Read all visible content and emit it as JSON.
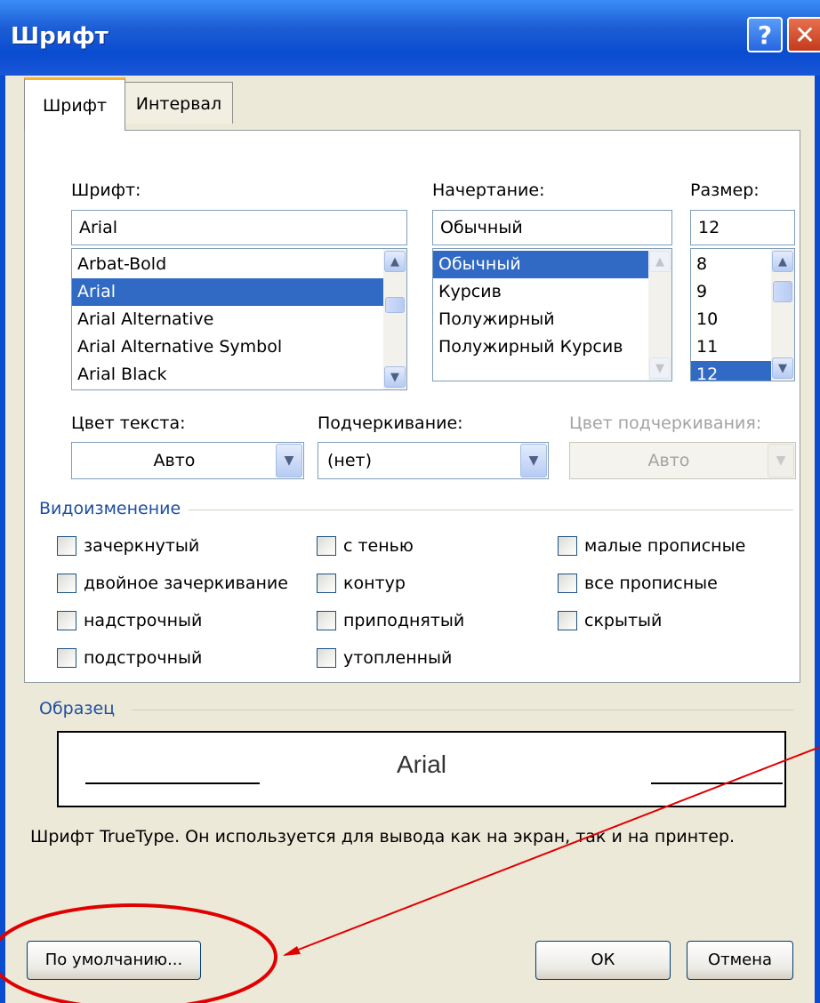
{
  "window": {
    "title": "Шрифт",
    "help_label": "?",
    "close_label": "✕"
  },
  "tabs": [
    {
      "label": "Шрифт"
    },
    {
      "label": "Интервал"
    }
  ],
  "font": {
    "label": "Шрифт:",
    "value": "Arial",
    "items": [
      "Arbat-Bold",
      "Arial",
      "Arial Alternative",
      "Arial Alternative Symbol",
      "Arial Black"
    ],
    "selected": "Arial"
  },
  "style": {
    "label": "Начертание:",
    "value": "Обычный",
    "items": [
      "Обычный",
      "Курсив",
      "Полужирный",
      "Полужирный Курсив"
    ],
    "selected": "Обычный"
  },
  "size": {
    "label": "Размер:",
    "value": "12",
    "items": [
      "8",
      "9",
      "10",
      "11",
      "12"
    ],
    "selected": "12"
  },
  "text_color": {
    "label": "Цвет текста:",
    "value": "Авто"
  },
  "underline": {
    "label": "Подчеркивание:",
    "value": "(нет)"
  },
  "underline_color": {
    "label": "Цвет подчеркивания:",
    "value": "Авто"
  },
  "effects": {
    "title": "Видоизменение",
    "col1": [
      "зачеркнутый",
      "двойное зачеркивание",
      "надстрочный",
      "подстрочный"
    ],
    "col2": [
      "с тенью",
      "контур",
      "приподнятый",
      "утопленный"
    ],
    "col3": [
      "малые прописные",
      "все прописные",
      "скрытый"
    ]
  },
  "preview": {
    "title": "Образец",
    "text": "Arial",
    "description": "Шрифт TrueType. Он используется для вывода как на экран, так и на принтер."
  },
  "buttons": {
    "default": "По умолчанию...",
    "ok": "ОК",
    "cancel": "Отмена"
  },
  "colors": {
    "titlebar": "#0A4CD0",
    "selection": "#316AC5",
    "annotation": "#E00000",
    "dialog_bg": "#ECE9D8"
  },
  "icons": {
    "help": "question-icon",
    "close": "close-icon",
    "scroll_up": "chevron-up-icon",
    "scroll_down": "chevron-down-icon"
  }
}
